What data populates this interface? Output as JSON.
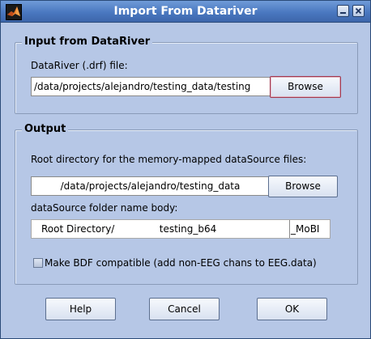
{
  "window": {
    "title": "Import From Datariver"
  },
  "titlebar_icons": {
    "app": "matlab-logo-icon",
    "minimize": "minimize-icon",
    "close": "close-icon"
  },
  "input_section": {
    "title": "Input from DataRiver",
    "file_label": "DataRiver (.drf) file:",
    "file_value": "/data/projects/alejandro/testing_data/testing",
    "browse_label": "Browse"
  },
  "output_section": {
    "title": "Output",
    "root_dir_label": "Root directory for the memory-mapped dataSource files:",
    "root_dir_value": "/data/projects/alejandro/testing_data",
    "browse_label": "Browse",
    "folder_name_label": "dataSource folder name body:",
    "folder_prefix": "Root Directory/",
    "folder_name_value": "testing_b64",
    "folder_suffix": "_MoBI",
    "bdf_checkbox_label": "Make BDF compatible (add non-EEG chans to EEG.data)",
    "bdf_checked": false
  },
  "buttons": {
    "help": "Help",
    "cancel": "Cancel",
    "ok": "OK"
  },
  "colors": {
    "window_bg": "#b6c7e6",
    "titlebar": "#4a78c0",
    "focus_border": "#a0384f"
  }
}
